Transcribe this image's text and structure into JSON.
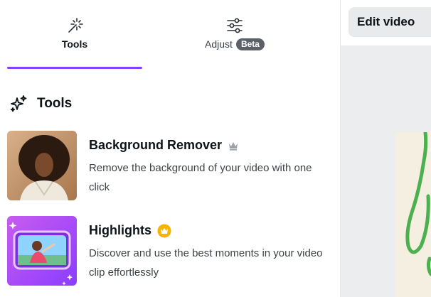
{
  "tabs": [
    {
      "label": "Tools",
      "icon": "magic-wand-icon",
      "active": true
    },
    {
      "label": "Adjust",
      "icon": "sliders-icon",
      "badge": "Beta",
      "active": false
    }
  ],
  "section": {
    "title": "Tools",
    "icon": "sparkles-icon"
  },
  "tools": [
    {
      "name": "Background Remover",
      "badge_icon": "crown-icon",
      "description": "Remove the background of your video with one click"
    },
    {
      "name": "Highlights",
      "badge_icon": "gold-crown-icon",
      "description": "Discover and use the best moments in your video clip effortlessly"
    }
  ],
  "edit_video": {
    "label": "Edit video"
  },
  "colors": {
    "accent": "#8b3dff",
    "premium_gold": "#f5b400",
    "canvas_stroke": "#4caf50"
  }
}
